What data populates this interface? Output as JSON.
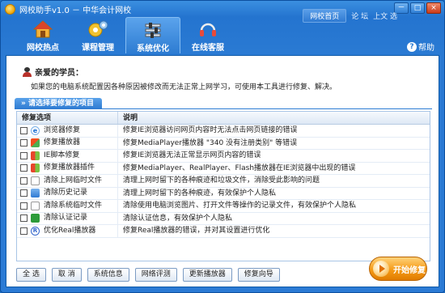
{
  "app": {
    "title": "网校助手v1.0 － 中华会计网校"
  },
  "toplinks": {
    "home": "网校首页",
    "link1": "论 坛",
    "link2": "上文 选"
  },
  "window_buttons": {
    "minimize": "－",
    "maximize": "□",
    "close": "×"
  },
  "tabs": [
    {
      "label": "网校热点",
      "icon": "house-icon"
    },
    {
      "label": "课程管理",
      "icon": "gears-icon"
    },
    {
      "label": "系统优化",
      "icon": "tools-icon",
      "active": true
    },
    {
      "label": "在线客服",
      "icon": "headset-icon"
    }
  ],
  "help": {
    "label": "帮助",
    "icon_glyph": "?"
  },
  "greeting": "亲爱的学员：",
  "intro": "如果您的电脑系统配置因各种原因被修改而无法正常上网学习，可使用本工具进行修复、解决。",
  "section_title": "» 请选择要修复的项目",
  "table": {
    "headers": {
      "item": "修复选项",
      "desc": "说明"
    },
    "rows": [
      {
        "item": "浏览器修复",
        "icon": "ie-icon",
        "desc": "修复IE浏览器访问网页内容时无法点击网页链接的错误"
      },
      {
        "item": "修复播放器",
        "icon": "media-player-icon",
        "desc": "修复MediaPlayer播放器 \"340 没有注册类别\" 等错误"
      },
      {
        "item": "IE脚本修复",
        "icon": "windows-icon",
        "desc": "修复IE浏览器无法正常显示网页内容的错误"
      },
      {
        "item": "修复播放器插件",
        "icon": "windows-icon",
        "desc": "修复MediaPlayer、RealPlayer、Flash播放器在IE浏览器中出现的错误"
      },
      {
        "item": "清除上网临时文件",
        "icon": "document-icon",
        "desc": "清理上网时留下的各种痕迹和垃圾文件，消除受此影响的问题"
      },
      {
        "item": "清除历史记录",
        "icon": "history-icon",
        "desc": "清理上网时留下的各种痕迹，有效保护个人隐私"
      },
      {
        "item": "清除系统临时文件",
        "icon": "document-icon",
        "desc": "清除使用电脑浏览图片、打开文件等操作的记录文件，有效保护个人隐私"
      },
      {
        "item": "清除认证记录",
        "icon": "certificate-icon",
        "desc": "清除认证信息，有效保护个人隐私"
      },
      {
        "item": "优化Real播放器",
        "icon": "real-player-icon",
        "desc": "修复Real播放器的错误，并对其设置进行优化"
      }
    ]
  },
  "buttons": {
    "select_all": "全 选",
    "cancel": "取 消",
    "system_info": "系统信息",
    "network_test": "网络评测",
    "update_player": "更新播放器",
    "repair_guide": "修复向导",
    "start_repair": "开始修复"
  },
  "colors": {
    "accent": "#2a7ad3",
    "start": "#f59a16"
  }
}
